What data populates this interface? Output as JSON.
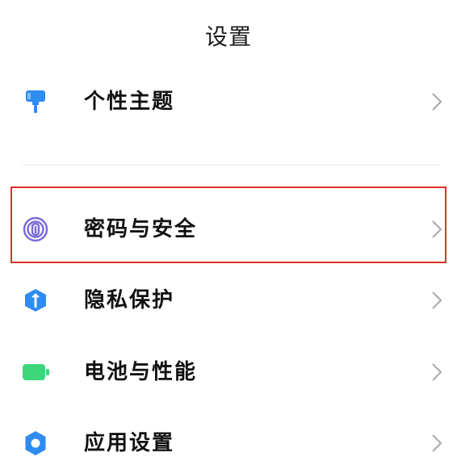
{
  "header": {
    "title": "设置"
  },
  "settings": {
    "items": [
      {
        "label": "个性主题",
        "icon": "brush-icon",
        "color": "#2e8bf0"
      },
      {
        "label": "密码与安全",
        "icon": "fingerprint-icon",
        "color": "#7b6cd9"
      },
      {
        "label": "隐私保护",
        "icon": "shield-icon",
        "color": "#2e8bf0"
      },
      {
        "label": "电池与性能",
        "icon": "battery-icon",
        "color": "#3dd67a"
      },
      {
        "label": "应用设置",
        "icon": "gear-icon",
        "color": "#2e8bf0"
      }
    ]
  },
  "highlight": {
    "color": "#e0302a",
    "target": "密码与安全"
  }
}
